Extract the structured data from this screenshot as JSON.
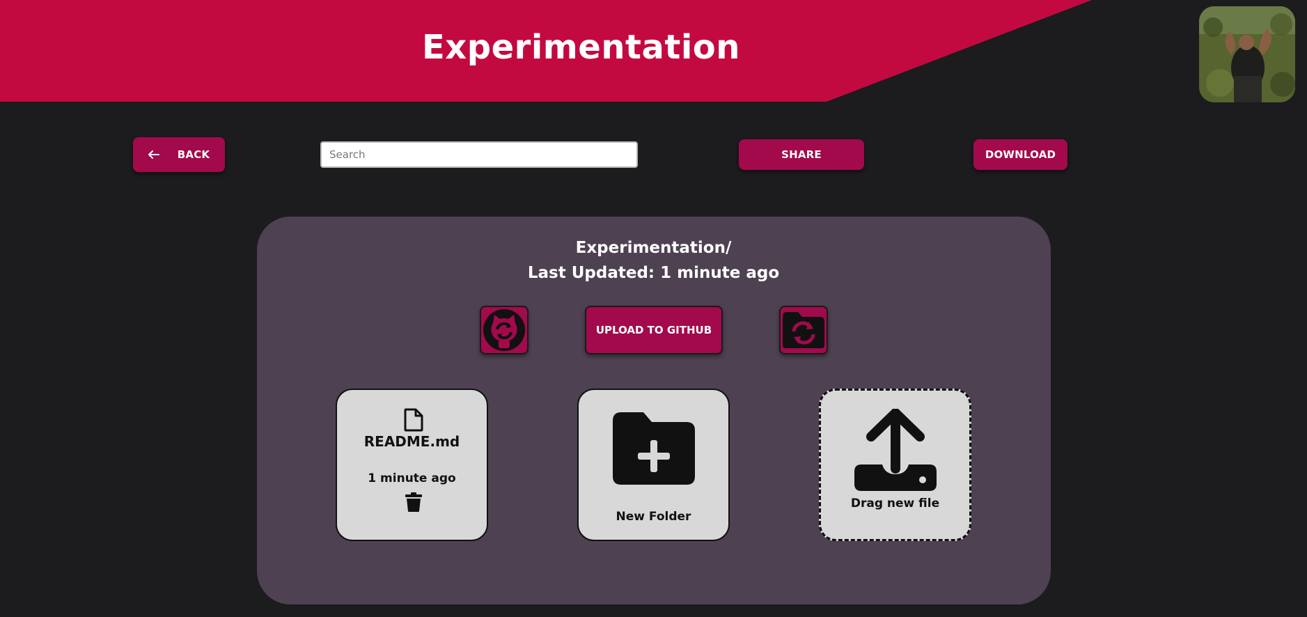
{
  "header": {
    "title": "Experimentation",
    "accent_color": "#c30a40"
  },
  "toolbar": {
    "back_label": "BACK",
    "back_icon": "arrow-left-icon",
    "search_placeholder": "Search",
    "search_value": "",
    "share_label": "SHARE",
    "download_label": "DOWNLOAD",
    "button_color": "#a20a4b"
  },
  "panel": {
    "folder_name": "Experimentation/",
    "last_updated_label": "Last Updated:",
    "last_updated_value": "1 minute ago",
    "upload_label": "UPLOAD TO GITHUB",
    "sync_github_icon": "github-sync-icon",
    "sync_folder_icon": "folder-sync-icon",
    "background_color": "#4e4152"
  },
  "files": [
    {
      "name": "README.md",
      "modified": "1 minute ago",
      "icon": "file-icon",
      "action_icon": "trash-icon"
    }
  ],
  "new_folder": {
    "label": "New Folder",
    "icon": "folder-plus-icon"
  },
  "drop_zone": {
    "label": "Drag new file",
    "icon": "upload-icon"
  },
  "user": {
    "avatar_icon": "avatar-photo"
  }
}
